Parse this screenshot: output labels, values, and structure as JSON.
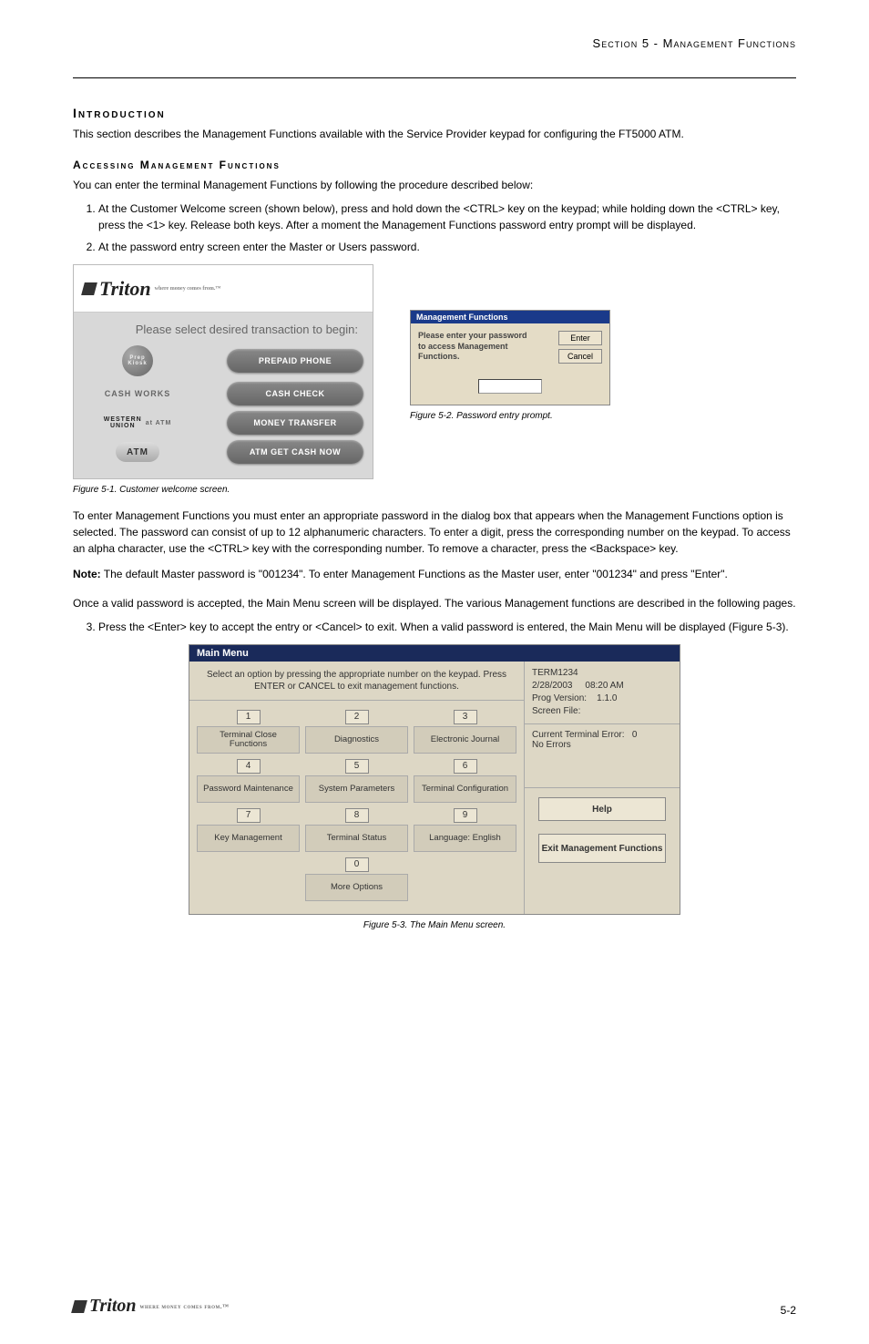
{
  "page": {
    "header_right": "Section 5 - Management Functions",
    "section_title": "Introduction",
    "intro_p1": "This section describes the Management Functions available with the Service Provider keypad for configuring the FT5000 ATM.",
    "sub1": "Accessing Management Functions",
    "access_p1": "You can enter the terminal Management Functions by following the procedure described below:",
    "ol1_1": "At the Customer Welcome screen (shown below), press and hold down the <CTRL> key on the keypad; while holding down the <CTRL> key, press the <1> key. Release both keys. After a moment the Management Functions password entry prompt will be displayed.",
    "ol1_2": "At the password entry screen enter the Master or Users password.",
    "welcome": {
      "prompt_line": "Please select desired transaction to begin:",
      "opt1": "PREPAID PHONE",
      "opt2_left": "CASH WORKS",
      "opt2": "CASH CHECK",
      "opt3_left_top": "WESTERN",
      "opt3_left_bot": "UNION",
      "opt3_left_suffix": "at ATM",
      "opt3": "MONEY TRANSFER",
      "opt4_left": "ATM",
      "opt4": "ATM GET CASH NOW",
      "badge_text": "Prep Kiosk"
    },
    "pw": {
      "title": "Management Functions",
      "text": "Please enter your password to access Management Functions.",
      "enter": "Enter",
      "cancel": "Cancel"
    },
    "fig1_caption": "Figure 5-1. Customer welcome screen.",
    "fig2_caption": "Figure 5-2. Password entry prompt.",
    "access_p2": "To enter Management Functions you must enter an appropriate password in the dialog box that appears when the Management Functions option is selected. The password can consist of up to 12 alphanumeric characters. To enter a digit, press the corresponding number on the keypad. To access an alpha character, use the <CTRL> key with the corresponding number. To remove a character, press the <Backspace> key.",
    "note_label": "Note:",
    "note_text": " The default Master password is \"001234\". To enter Management Functions as the Master user, enter \"001234\" and press \"Enter\".",
    "access_p3": "Once a valid password is accepted, the Main Menu screen will be displayed. The various Management functions are described in the following pages.",
    "ol2_1": "Press the <Enter> key to accept the entry or <Cancel> to exit. When a valid password is entered, the Main Menu will be displayed (Figure 5-3).",
    "mainmenu": {
      "title": "Main Menu",
      "instr": "Select an option by pressing the appropriate number on the keypad. Press ENTER or CANCEL to exit management functions.",
      "cells": [
        {
          "n": "1",
          "l": "Terminal Close Functions"
        },
        {
          "n": "2",
          "l": "Diagnostics"
        },
        {
          "n": "3",
          "l": "Electronic Journal"
        },
        {
          "n": "4",
          "l": "Password Maintenance"
        },
        {
          "n": "5",
          "l": "System Parameters"
        },
        {
          "n": "6",
          "l": "Terminal Configuration"
        },
        {
          "n": "7",
          "l": "Key Management"
        },
        {
          "n": "8",
          "l": "Terminal Status"
        },
        {
          "n": "9",
          "l": "Language: English"
        },
        {
          "n": "0",
          "l": "More Options"
        }
      ],
      "term_id": "TERM1234",
      "date": "2/28/2003",
      "time": "08:20 AM",
      "prog_label": "Prog Version:",
      "prog_ver": "1.1.0",
      "screen_label": "Screen File:",
      "err_label": "Current Terminal Error:",
      "err_code": "0",
      "err_text": "No Errors",
      "help": "Help",
      "exit": "Exit Management Functions"
    },
    "fig3_caption": "Figure 5-3. The Main Menu screen.",
    "page_num": "5-2",
    "footer_brand": "Triton",
    "footer_tag": "where money comes from.™"
  }
}
